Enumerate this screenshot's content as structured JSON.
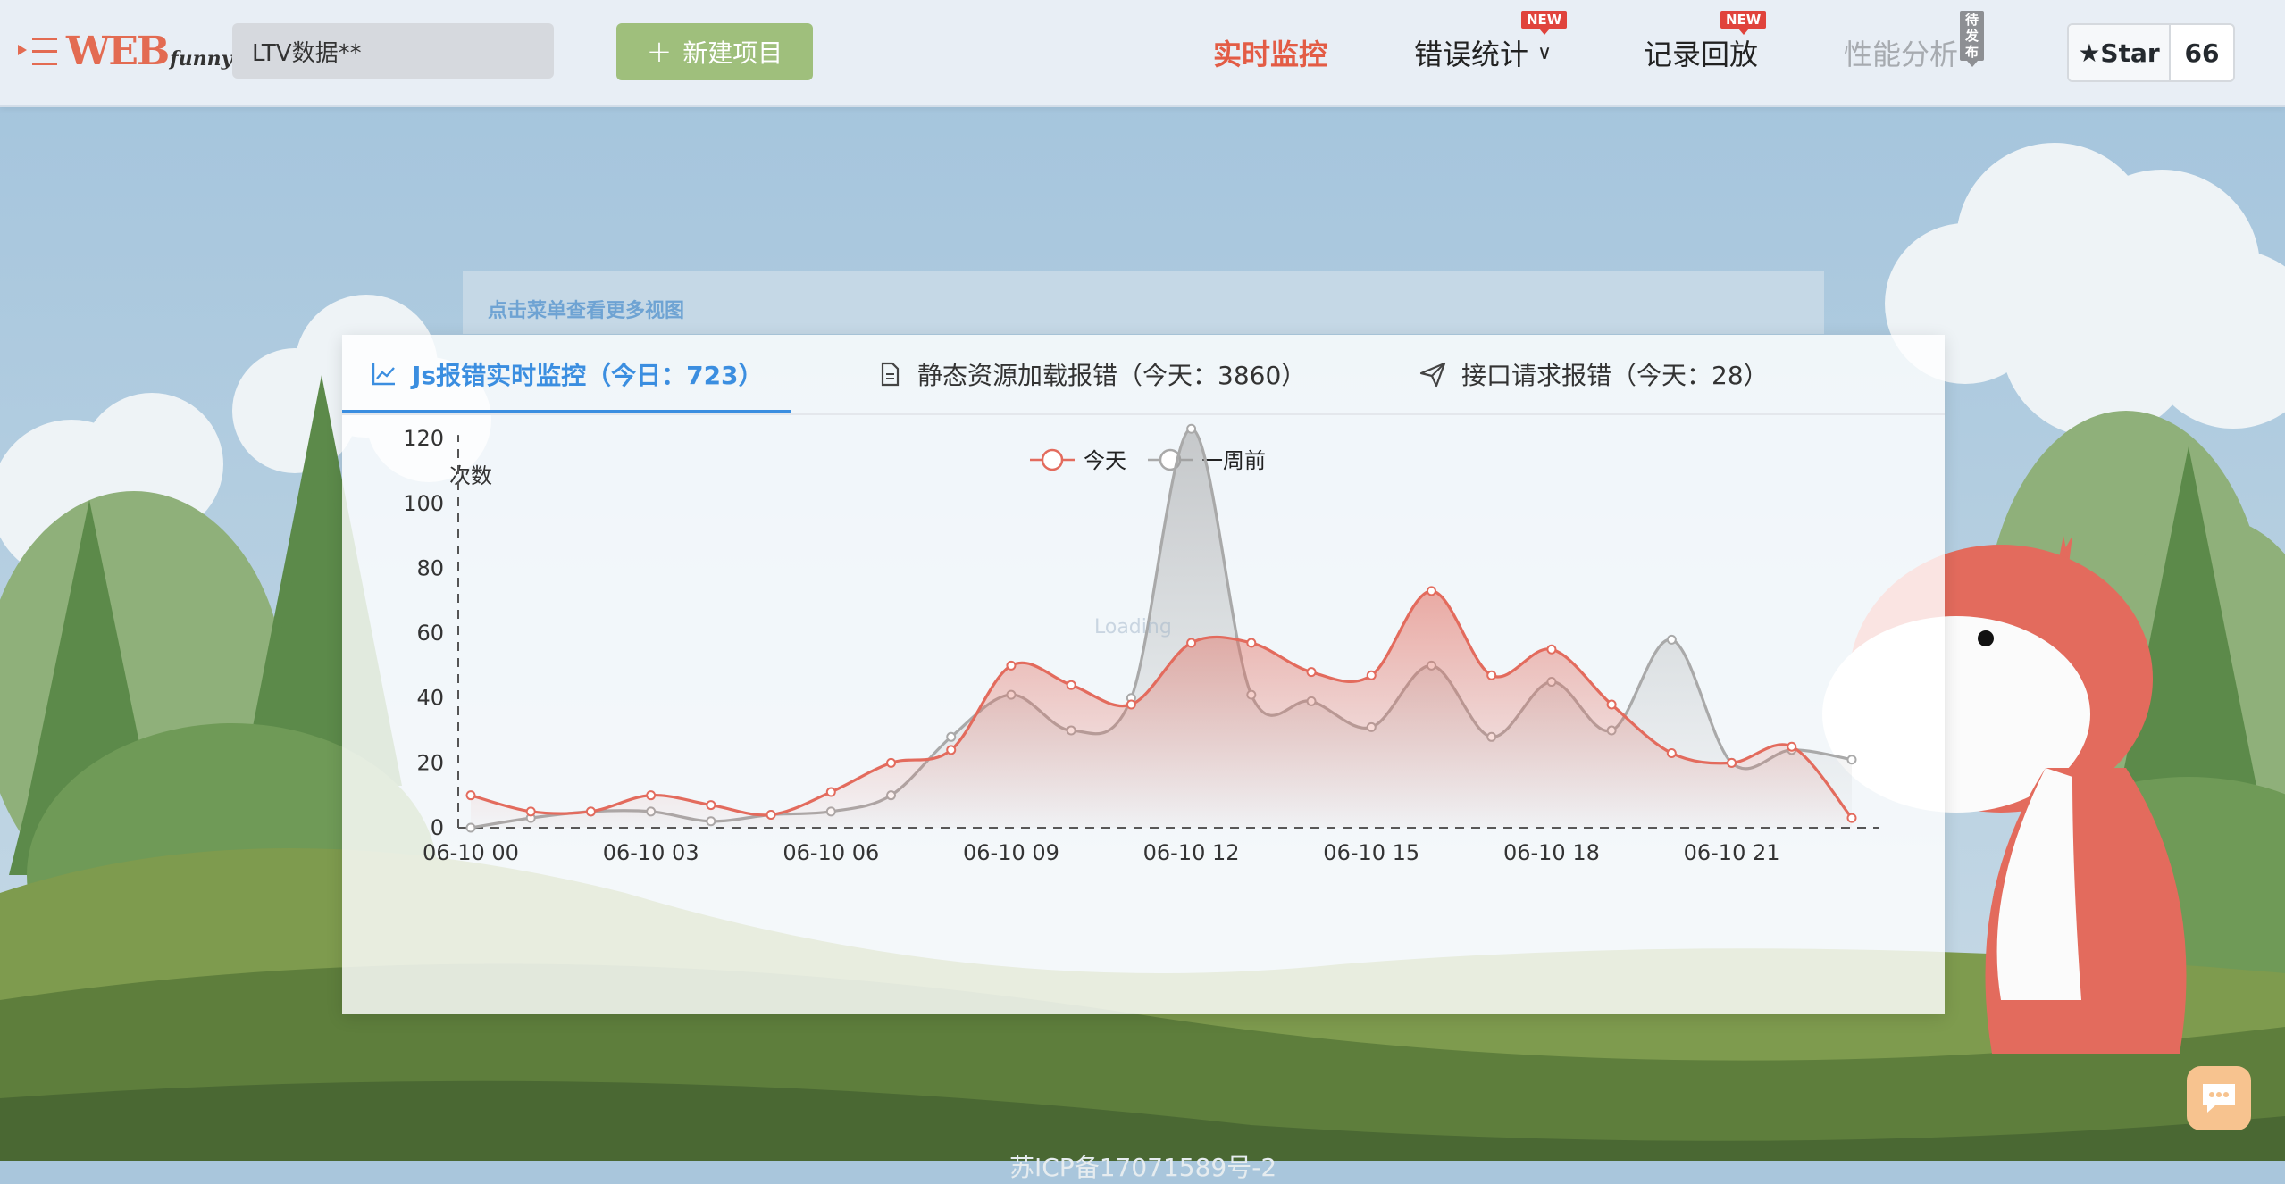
{
  "header": {
    "logo_main": "WEB",
    "logo_sub": "funny",
    "search_value": "LTV数据**",
    "new_project_label": "新建项目",
    "nav": {
      "realtime": "实时监控",
      "errors": "错误统计",
      "errors_badge": "NEW",
      "replay": "记录回放",
      "replay_badge": "NEW",
      "performance": "性能分析",
      "performance_badge": "待发布"
    },
    "star_label": "Star",
    "star_count": "66"
  },
  "hint": "点击菜单查看更多视图",
  "tabs": [
    {
      "label": "Js报错实时监控（今日：723）"
    },
    {
      "label": "静态资源加载报错（今天：3860）"
    },
    {
      "label": "接口请求报错（今天：28）"
    }
  ],
  "loading_text": "Loading",
  "footer_text": "苏ICP备17071589号-2",
  "colors": {
    "accent": "#3b8ee0",
    "today": "#e36b5d",
    "week_ago": "#a9a9a9",
    "nav_active": "#e35c45",
    "nav_disabled": "#a7abb0"
  },
  "chart_data": {
    "type": "line",
    "ylabel": "次数",
    "ylim": [
      0,
      120
    ],
    "yticks": [
      0,
      20,
      40,
      60,
      80,
      100,
      120
    ],
    "x": [
      "06-10 00",
      "06-10 01",
      "06-10 02",
      "06-10 03",
      "06-10 04",
      "06-10 05",
      "06-10 06",
      "06-10 07",
      "06-10 08",
      "06-10 09",
      "06-10 10",
      "06-10 11",
      "06-10 12",
      "06-10 13",
      "06-10 14",
      "06-10 15",
      "06-10 16",
      "06-10 17",
      "06-10 18",
      "06-10 19",
      "06-10 20",
      "06-10 21",
      "06-10 22",
      "06-10 23"
    ],
    "xtick_labels": [
      "06-10 00",
      "06-10 03",
      "06-10 06",
      "06-10 09",
      "06-10 12",
      "06-10 15",
      "06-10 18",
      "06-10 21"
    ],
    "legend_position": "top-center",
    "series": [
      {
        "name": "今天",
        "values": [
          10,
          5,
          5,
          10,
          7,
          4,
          11,
          20,
          24,
          50,
          44,
          38,
          57,
          57,
          48,
          47,
          73,
          47,
          55,
          38,
          23,
          20,
          25,
          3
        ]
      },
      {
        "name": "一周前",
        "values": [
          0,
          3,
          5,
          5,
          2,
          4,
          5,
          10,
          28,
          41,
          30,
          40,
          123,
          41,
          39,
          31,
          50,
          28,
          45,
          30,
          58,
          20,
          24,
          21
        ]
      }
    ]
  }
}
